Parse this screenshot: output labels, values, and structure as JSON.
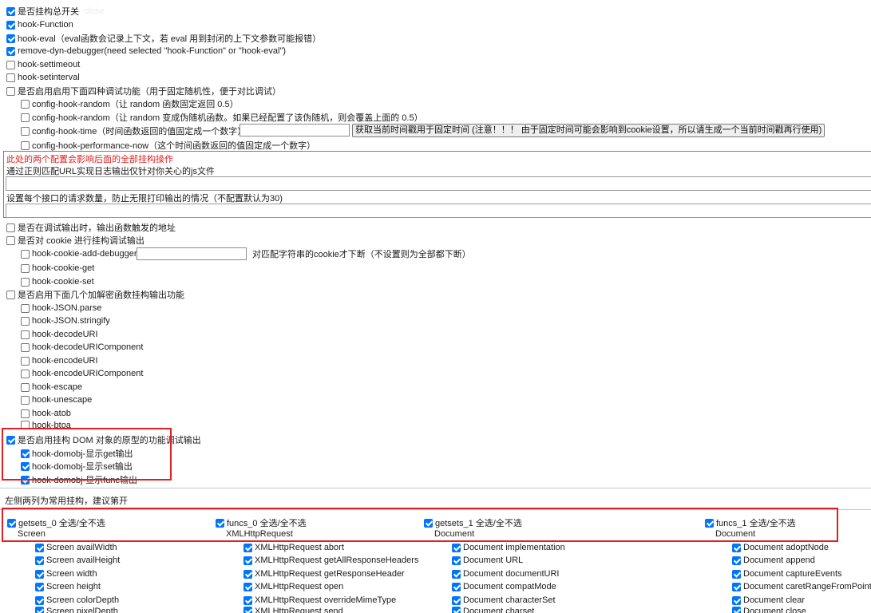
{
  "colors": {
    "accent": "#0075ff",
    "red_border": "#e05252",
    "highlight": "#e02020",
    "red_text": "#e01e1e"
  },
  "top": [
    {
      "label": "是否挂构总开关",
      "checked": true
    },
    {
      "label": "hook-Function",
      "checked": true
    },
    {
      "label": "hook-eval（eval函数会记录上下文，若 eval 用到封闭的上下文参数可能报错）",
      "checked": true
    },
    {
      "label": "remove-dyn-debugger(need selected \"hook-Function\" or \"hook-eval\")",
      "checked": true
    },
    {
      "label": "hook-settimeout",
      "checked": false
    },
    {
      "label": "hook-setinterval",
      "checked": false
    },
    {
      "label": "是否启用启用下面四种调试功能（用于固定随机性，便于对比调试）",
      "checked": false
    }
  ],
  "top_faint": "close",
  "config": [
    {
      "label": "config-hook-random（让 random 函数固定返回 0.5）",
      "checked": false
    },
    {
      "label": "config-hook-random（让 random 变成伪随机函数。如果已经配置了该伪随机，则会覆盖上面的 0.5）",
      "checked": false
    },
    {
      "label": "config-hook-time（时间函数返回的值固定成一个数字）",
      "checked": false
    },
    {
      "label": "config-hook-performance-now（这个时间函数返回的值固定成一个数字）",
      "checked": false
    }
  ],
  "time_button": "获取当前时间戳用于固定时间 (注意！！！ 由于固定时间可能会影响到cookie设置，所以请生成一个当前时间戳再行使用)",
  "redbox": {
    "warning": "此处的两个配置会影响后面的全部挂构操作",
    "regex_label": "通过正则匹配URL实现日志输出仅针对你关心的js文件",
    "limit_label": "设置每个接口的请求数量，防止无限打印输出的情况（不配置默认为30)"
  },
  "mid": [
    {
      "label": "是否在调试输出时，输出函数触发的地址",
      "checked": false
    },
    {
      "label": "是否对 cookie 进行挂构调试输出",
      "checked": false
    }
  ],
  "cookie": [
    {
      "label": "hook-cookie-add-debugger",
      "checked": false
    },
    {
      "label": "hook-cookie-get",
      "checked": false
    },
    {
      "label": "hook-cookie-set",
      "checked": false
    }
  ],
  "cookie_hint": "对匹配字符串的cookie才下断（不设置则为全部都下断）",
  "crypto_head": {
    "label": "是否启用下面几个加解密函数挂构输出功能",
    "checked": false
  },
  "crypto": [
    "hook-JSON.parse",
    "hook-JSON.stringify",
    "hook-decodeURI",
    "hook-decodeURIComponent",
    "hook-encodeURI",
    "hook-encodeURIComponent",
    "hook-escape",
    "hook-unescape",
    "hook-atob",
    "hook-btoa"
  ],
  "dom_head": {
    "label": "是否启用挂构 DOM 对象的原型的功能调试输出",
    "checked": true
  },
  "dom": [
    {
      "label": "hook-domobj-显示get输出",
      "checked": true
    },
    {
      "label": "hook-domobj-显示set输出",
      "checked": true
    },
    {
      "label": "hook-domobj-显示func输出",
      "checked": true
    }
  ],
  "section_note": "左侧两列为常用挂构，建议第开",
  "columns": [
    {
      "head": "getsets_0 全选/全不选",
      "sub": "Screen",
      "items": [
        "Screen availWidth",
        "Screen availHeight",
        "Screen width",
        "Screen height",
        "Screen colorDepth",
        "Screen pixelDepth"
      ]
    },
    {
      "head": "funcs_0 全选/全不选",
      "sub": "XMLHttpRequest",
      "items": [
        "XMLHttpRequest abort",
        "XMLHttpRequest getAllResponseHeaders",
        "XMLHttpRequest getResponseHeader",
        "XMLHttpRequest open",
        "XMLHttpRequest overrideMimeType",
        "XMLHttpRequest send"
      ]
    },
    {
      "head": "getsets_1 全选/全不选",
      "sub": "Document",
      "items": [
        "Document implementation",
        "Document URL",
        "Document documentURI",
        "Document compatMode",
        "Document characterSet",
        "Document charset"
      ]
    },
    {
      "head": "funcs_1 全选/全不选",
      "sub": "Document",
      "items": [
        "Document adoptNode",
        "Document append",
        "Document captureEvents",
        "Document caretRangeFromPoint",
        "Document clear",
        "Document close"
      ]
    }
  ]
}
